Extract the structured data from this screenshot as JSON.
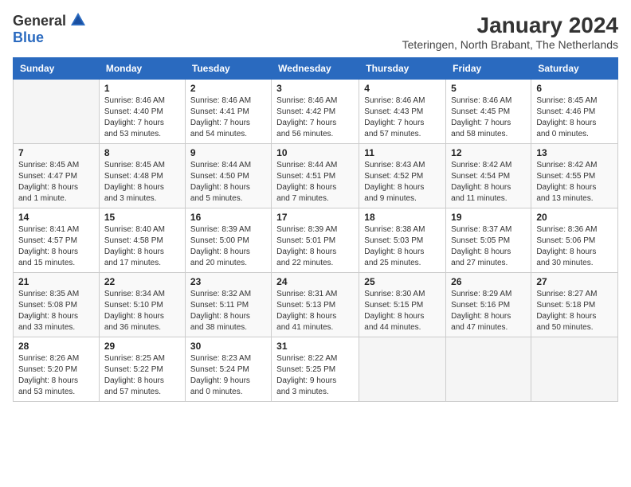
{
  "logo": {
    "general": "General",
    "blue": "Blue"
  },
  "title": {
    "month_year": "January 2024",
    "location": "Teteringen, North Brabant, The Netherlands"
  },
  "headers": [
    "Sunday",
    "Monday",
    "Tuesday",
    "Wednesday",
    "Thursday",
    "Friday",
    "Saturday"
  ],
  "weeks": [
    [
      {
        "day": "",
        "info": ""
      },
      {
        "day": "1",
        "info": "Sunrise: 8:46 AM\nSunset: 4:40 PM\nDaylight: 7 hours\nand 53 minutes."
      },
      {
        "day": "2",
        "info": "Sunrise: 8:46 AM\nSunset: 4:41 PM\nDaylight: 7 hours\nand 54 minutes."
      },
      {
        "day": "3",
        "info": "Sunrise: 8:46 AM\nSunset: 4:42 PM\nDaylight: 7 hours\nand 56 minutes."
      },
      {
        "day": "4",
        "info": "Sunrise: 8:46 AM\nSunset: 4:43 PM\nDaylight: 7 hours\nand 57 minutes."
      },
      {
        "day": "5",
        "info": "Sunrise: 8:46 AM\nSunset: 4:45 PM\nDaylight: 7 hours\nand 58 minutes."
      },
      {
        "day": "6",
        "info": "Sunrise: 8:45 AM\nSunset: 4:46 PM\nDaylight: 8 hours\nand 0 minutes."
      }
    ],
    [
      {
        "day": "7",
        "info": "Sunrise: 8:45 AM\nSunset: 4:47 PM\nDaylight: 8 hours\nand 1 minute."
      },
      {
        "day": "8",
        "info": "Sunrise: 8:45 AM\nSunset: 4:48 PM\nDaylight: 8 hours\nand 3 minutes."
      },
      {
        "day": "9",
        "info": "Sunrise: 8:44 AM\nSunset: 4:50 PM\nDaylight: 8 hours\nand 5 minutes."
      },
      {
        "day": "10",
        "info": "Sunrise: 8:44 AM\nSunset: 4:51 PM\nDaylight: 8 hours\nand 7 minutes."
      },
      {
        "day": "11",
        "info": "Sunrise: 8:43 AM\nSunset: 4:52 PM\nDaylight: 8 hours\nand 9 minutes."
      },
      {
        "day": "12",
        "info": "Sunrise: 8:42 AM\nSunset: 4:54 PM\nDaylight: 8 hours\nand 11 minutes."
      },
      {
        "day": "13",
        "info": "Sunrise: 8:42 AM\nSunset: 4:55 PM\nDaylight: 8 hours\nand 13 minutes."
      }
    ],
    [
      {
        "day": "14",
        "info": "Sunrise: 8:41 AM\nSunset: 4:57 PM\nDaylight: 8 hours\nand 15 minutes."
      },
      {
        "day": "15",
        "info": "Sunrise: 8:40 AM\nSunset: 4:58 PM\nDaylight: 8 hours\nand 17 minutes."
      },
      {
        "day": "16",
        "info": "Sunrise: 8:39 AM\nSunset: 5:00 PM\nDaylight: 8 hours\nand 20 minutes."
      },
      {
        "day": "17",
        "info": "Sunrise: 8:39 AM\nSunset: 5:01 PM\nDaylight: 8 hours\nand 22 minutes."
      },
      {
        "day": "18",
        "info": "Sunrise: 8:38 AM\nSunset: 5:03 PM\nDaylight: 8 hours\nand 25 minutes."
      },
      {
        "day": "19",
        "info": "Sunrise: 8:37 AM\nSunset: 5:05 PM\nDaylight: 8 hours\nand 27 minutes."
      },
      {
        "day": "20",
        "info": "Sunrise: 8:36 AM\nSunset: 5:06 PM\nDaylight: 8 hours\nand 30 minutes."
      }
    ],
    [
      {
        "day": "21",
        "info": "Sunrise: 8:35 AM\nSunset: 5:08 PM\nDaylight: 8 hours\nand 33 minutes."
      },
      {
        "day": "22",
        "info": "Sunrise: 8:34 AM\nSunset: 5:10 PM\nDaylight: 8 hours\nand 36 minutes."
      },
      {
        "day": "23",
        "info": "Sunrise: 8:32 AM\nSunset: 5:11 PM\nDaylight: 8 hours\nand 38 minutes."
      },
      {
        "day": "24",
        "info": "Sunrise: 8:31 AM\nSunset: 5:13 PM\nDaylight: 8 hours\nand 41 minutes."
      },
      {
        "day": "25",
        "info": "Sunrise: 8:30 AM\nSunset: 5:15 PM\nDaylight: 8 hours\nand 44 minutes."
      },
      {
        "day": "26",
        "info": "Sunrise: 8:29 AM\nSunset: 5:16 PM\nDaylight: 8 hours\nand 47 minutes."
      },
      {
        "day": "27",
        "info": "Sunrise: 8:27 AM\nSunset: 5:18 PM\nDaylight: 8 hours\nand 50 minutes."
      }
    ],
    [
      {
        "day": "28",
        "info": "Sunrise: 8:26 AM\nSunset: 5:20 PM\nDaylight: 8 hours\nand 53 minutes."
      },
      {
        "day": "29",
        "info": "Sunrise: 8:25 AM\nSunset: 5:22 PM\nDaylight: 8 hours\nand 57 minutes."
      },
      {
        "day": "30",
        "info": "Sunrise: 8:23 AM\nSunset: 5:24 PM\nDaylight: 9 hours\nand 0 minutes."
      },
      {
        "day": "31",
        "info": "Sunrise: 8:22 AM\nSunset: 5:25 PM\nDaylight: 9 hours\nand 3 minutes."
      },
      {
        "day": "",
        "info": ""
      },
      {
        "day": "",
        "info": ""
      },
      {
        "day": "",
        "info": ""
      }
    ]
  ]
}
